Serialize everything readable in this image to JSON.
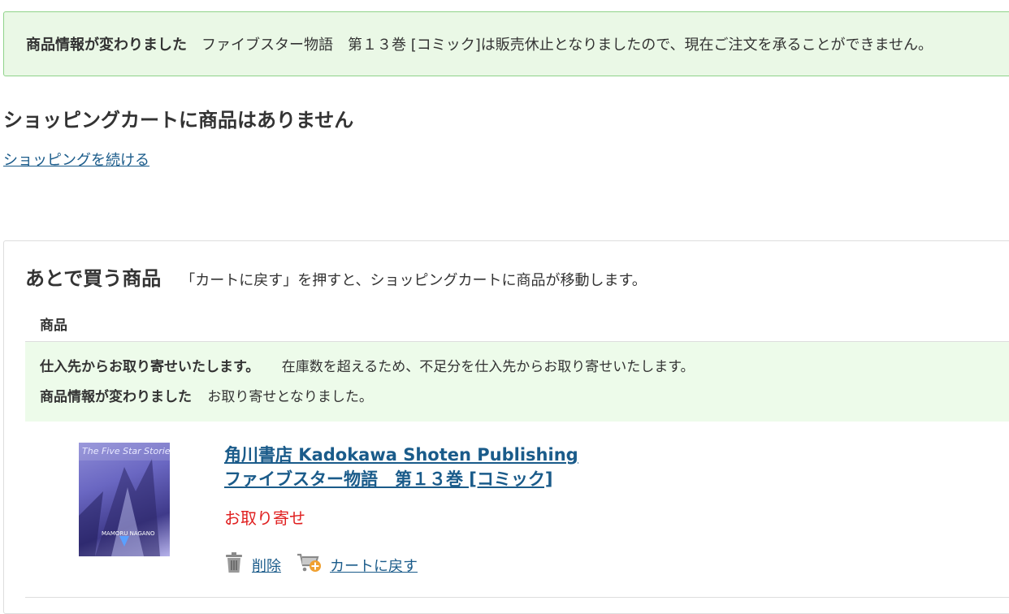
{
  "notice": {
    "label": "商品情報が変わりました",
    "message": "ファイブスター物語　第１３巻 [コミック]は販売休止となりましたので、現在ご注文を承ることができません。"
  },
  "cart": {
    "empty_heading": "ショッピングカートに商品はありません",
    "continue_link": "ショッピングを続ける"
  },
  "saved_for_later": {
    "title": "あとで買う商品",
    "description": "「カートに戻す」を押すと、ショッピングカートに商品が移動します。",
    "column_header": "商品",
    "messages": [
      {
        "label": "仕入先からお取り寄せいたします。",
        "text": "在庫数を超えるため、不足分を仕入先からお取り寄せいたします。"
      },
      {
        "label": "商品情報が変わりました",
        "text": "お取り寄せとなりました。"
      }
    ],
    "item": {
      "publisher": "角川書店 Kadokawa Shoten Publishing",
      "title": "ファイブスター物語　第１３巻 [コミック]",
      "status": "お取り寄せ",
      "cover_title": "The Five Star Stories",
      "cover_author": "MAMORU NAGANO",
      "status_color": "#e02020",
      "actions": {
        "delete_label": "削除",
        "delete_icon": "trash-icon",
        "move_label": "カートに戻す",
        "move_icon": "cart-add-icon"
      }
    }
  },
  "colors": {
    "link": "#1a5b8a",
    "notice_bg": "#eaf8e6",
    "notice_border": "#8fd38a"
  }
}
